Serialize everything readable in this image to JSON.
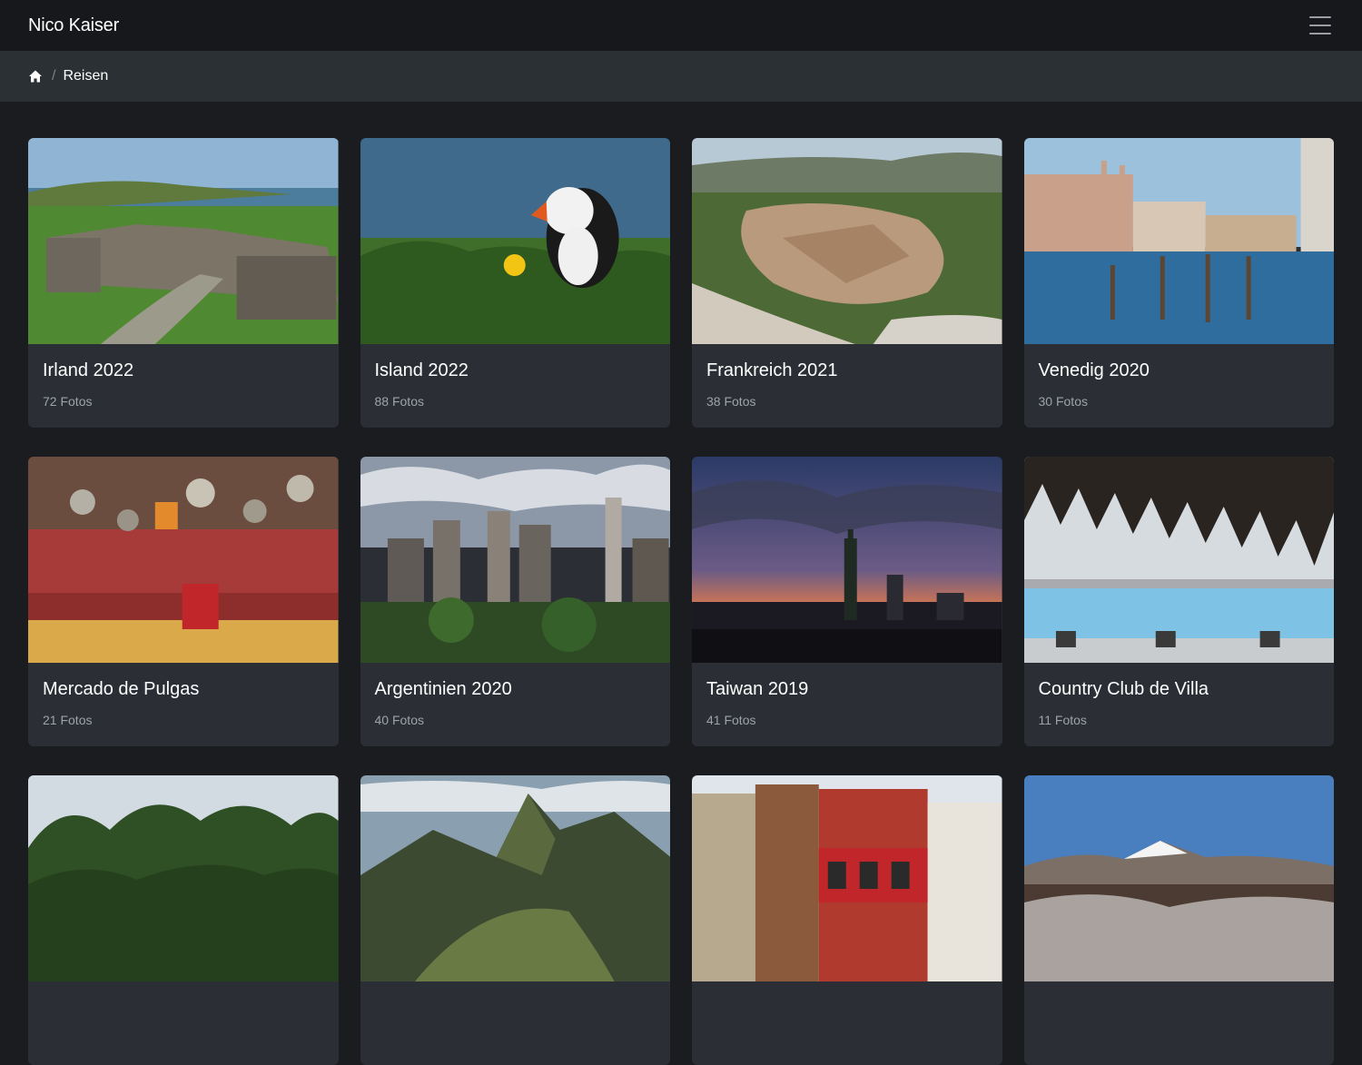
{
  "navbar": {
    "brand": "Nico Kaiser",
    "menu_icon": "hamburger-menu-icon"
  },
  "breadcrumb": {
    "home_icon": "home-icon",
    "separator": "/",
    "current": "Reisen"
  },
  "albums": [
    {
      "title": "Irland 2022",
      "count": "72 Fotos"
    },
    {
      "title": "Island 2022",
      "count": "88 Fotos"
    },
    {
      "title": "Frankreich 2021",
      "count": "38 Fotos"
    },
    {
      "title": "Venedig 2020",
      "count": "30 Fotos"
    },
    {
      "title": "Mercado de Pulgas",
      "count": "21 Fotos"
    },
    {
      "title": "Argentinien 2020",
      "count": "40 Fotos"
    },
    {
      "title": "Taiwan 2019",
      "count": "41 Fotos"
    },
    {
      "title": "Country Club de Villa",
      "count": "11 Fotos"
    },
    {
      "title": "",
      "count": ""
    },
    {
      "title": "",
      "count": ""
    },
    {
      "title": "",
      "count": ""
    },
    {
      "title": "",
      "count": ""
    }
  ]
}
